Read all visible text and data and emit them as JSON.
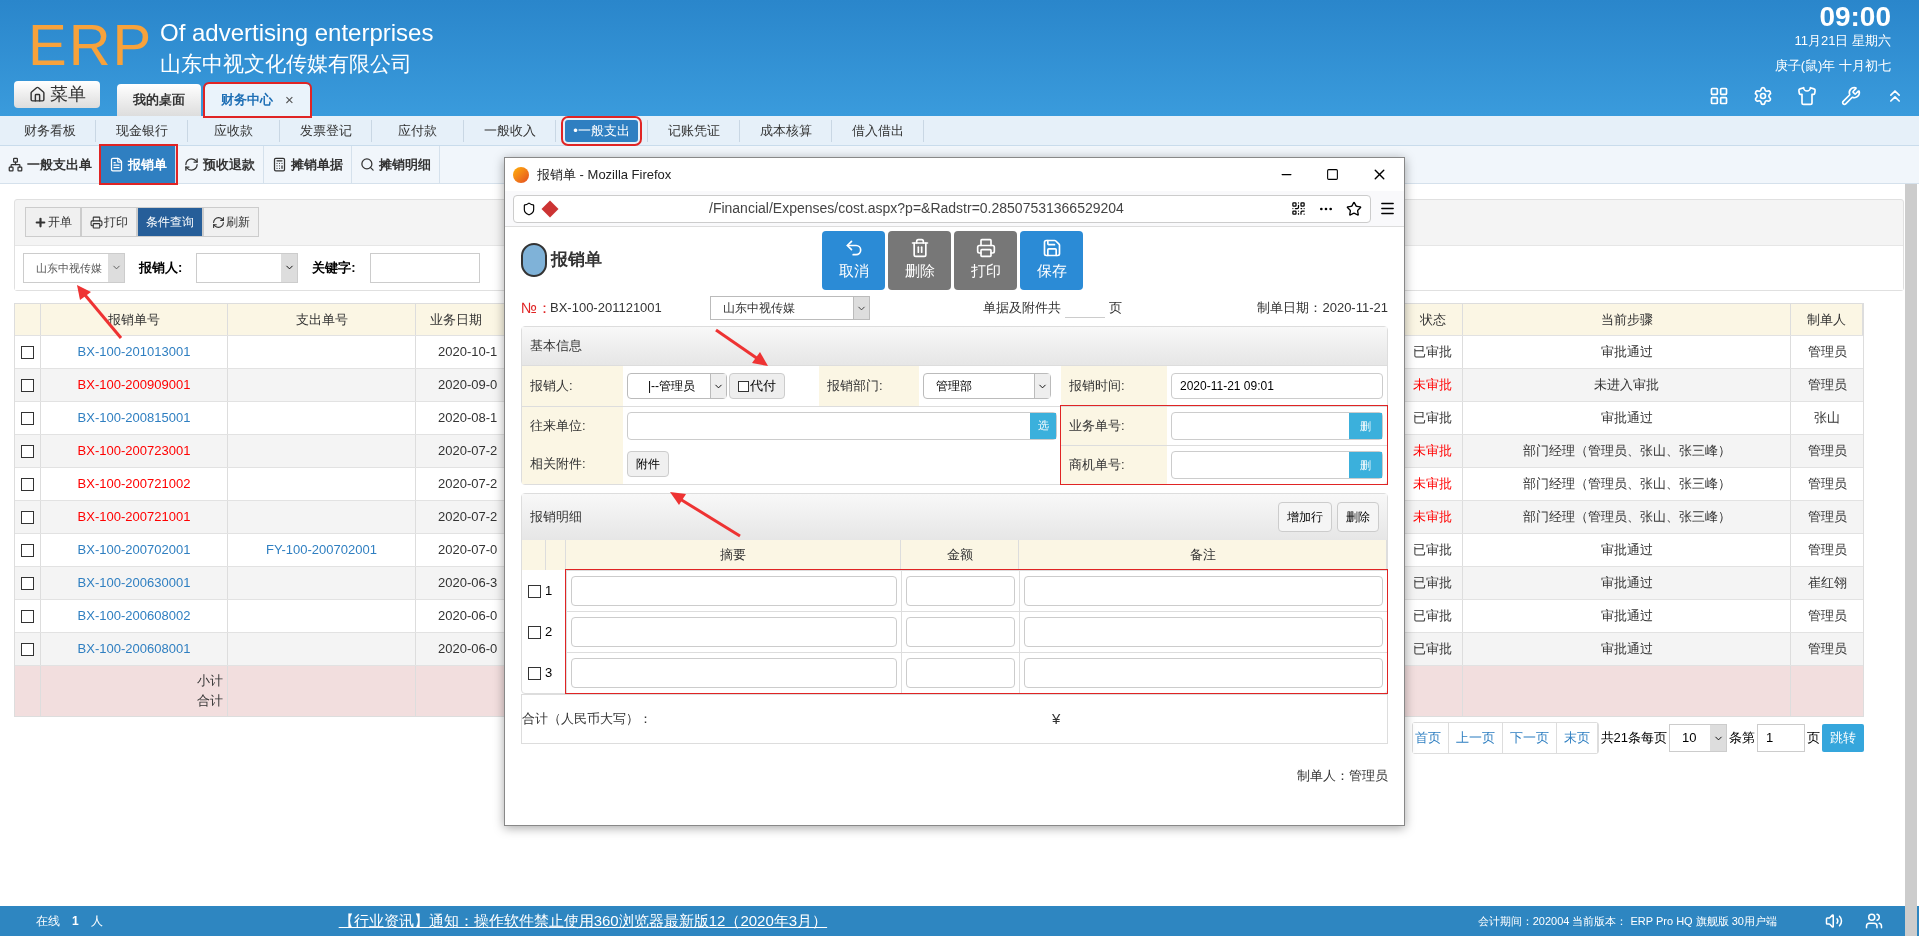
{
  "header": {
    "logo": "ERP",
    "subtitle_en": "Of advertising enterprises",
    "company": "山东中视文化传媒有限公司",
    "time": "09:00",
    "date": "11月21日 星期六",
    "lunar": "庚子(鼠)年 十月初七",
    "menu_button": "菜单"
  },
  "tabs": [
    {
      "label": "我的桌面",
      "selected": false,
      "highlighted": false,
      "closable": false
    },
    {
      "label": "财务中心",
      "selected": true,
      "highlighted": true,
      "closable": true,
      "close": "×"
    }
  ],
  "nav": [
    {
      "label": "财务看板",
      "selected": false
    },
    {
      "label": "现金银行",
      "selected": false
    },
    {
      "label": "应收款",
      "selected": false
    },
    {
      "label": "发票登记",
      "selected": false
    },
    {
      "label": "应付款",
      "selected": false
    },
    {
      "label": "一般收入",
      "selected": false
    },
    {
      "label": "一般支出",
      "selected": true,
      "bullet": "•"
    },
    {
      "label": "记账凭证",
      "selected": false
    },
    {
      "label": "成本核算",
      "selected": false
    },
    {
      "label": "借入借出",
      "selected": false
    }
  ],
  "subtabs": [
    {
      "label": "一般支出单",
      "selected": false
    },
    {
      "label": "报销单",
      "selected": true
    },
    {
      "label": "预收退款",
      "selected": false
    },
    {
      "label": "摊销单据",
      "selected": false
    },
    {
      "label": "摊销明细",
      "selected": false
    }
  ],
  "toolbar": [
    {
      "label": "开单",
      "kind": "add",
      "selected": false
    },
    {
      "label": "打印",
      "kind": "print",
      "selected": false
    },
    {
      "label": "条件查询",
      "kind": "query",
      "selected": true
    },
    {
      "label": "刷新",
      "kind": "refresh",
      "selected": false
    }
  ],
  "filters": {
    "company": "山东中视传媒",
    "person_label": "报销人:",
    "keyword_label": "关键字:"
  },
  "table": {
    "columns": [
      "报销单号",
      "支出单号",
      "业务日期",
      "状态",
      "当前步骤",
      "制单人"
    ],
    "rows": [
      {
        "number": "BX-100-201013001",
        "expense_no": "",
        "date": "2020-10-1",
        "status": "已审批",
        "step": "审批通过",
        "maker": "管理员",
        "flagged": false,
        "checked": false
      },
      {
        "number": "BX-100-200909001",
        "expense_no": "",
        "date": "2020-09-0",
        "status": "未审批",
        "step": "未进入审批",
        "maker": "管理员",
        "flagged": true,
        "checked": false
      },
      {
        "number": "BX-100-200815001",
        "expense_no": "",
        "date": "2020-08-1",
        "status": "已审批",
        "step": "审批通过",
        "maker": "张山",
        "flagged": false,
        "checked": false
      },
      {
        "number": "BX-100-200723001",
        "expense_no": "",
        "date": "2020-07-2",
        "status": "未审批",
        "step": "部门经理（管理员、张山、张三峰）",
        "maker": "管理员",
        "flagged": true,
        "checked": false
      },
      {
        "number": "BX-100-200721002",
        "expense_no": "",
        "date": "2020-07-2",
        "status": "未审批",
        "step": "部门经理（管理员、张山、张三峰）",
        "maker": "管理员",
        "flagged": true,
        "checked": false
      },
      {
        "number": "BX-100-200721001",
        "expense_no": "",
        "date": "2020-07-2",
        "status": "未审批",
        "step": "部门经理（管理员、张山、张三峰）",
        "maker": "管理员",
        "flagged": true,
        "checked": false
      },
      {
        "number": "BX-100-200702001",
        "expense_no": "FY-100-200702001",
        "date": "2020-07-0",
        "status": "已审批",
        "step": "审批通过",
        "maker": "管理员",
        "flagged": false,
        "checked": false
      },
      {
        "number": "BX-100-200630001",
        "expense_no": "",
        "date": "2020-06-3",
        "status": "已审批",
        "step": "审批通过",
        "maker": "崔红翎",
        "flagged": false,
        "checked": false
      },
      {
        "number": "BX-100-200608002",
        "expense_no": "",
        "date": "2020-06-0",
        "status": "已审批",
        "step": "审批通过",
        "maker": "管理员",
        "flagged": false,
        "checked": false
      },
      {
        "number": "BX-100-200608001",
        "expense_no": "",
        "date": "2020-06-0",
        "status": "已审批",
        "step": "审批通过",
        "maker": "管理员",
        "flagged": false,
        "checked": false
      }
    ],
    "subtotal": "小计",
    "total": "合计"
  },
  "pagination": {
    "buttons": [
      "首页",
      "上一页",
      "下一页",
      "末页"
    ],
    "summary": "共21条每页",
    "page_size": "10",
    "page_label": "条第",
    "page": "1",
    "page_suffix": "页",
    "go": "跳转"
  },
  "popup": {
    "title": "报销单 - Mozilla Firefox",
    "url": "/Financial/Expenses/cost.aspx?p=&Radstr=0.28507531366529204",
    "heading": "报销单",
    "actions": [
      {
        "label": "取消",
        "kind": "cancel"
      },
      {
        "label": "删除",
        "kind": "delete"
      },
      {
        "label": "打印",
        "kind": "print"
      },
      {
        "label": "保存",
        "kind": "save"
      }
    ],
    "no_label": "№：",
    "no": "BX-100-201121001",
    "company": "山东中视传媒",
    "pages_label": "单据及附件共",
    "pages_suffix": "页",
    "date_label": "制单日期：",
    "date": "2020-11-21",
    "basic_title": "基本信息",
    "person_label": "报销人:",
    "person": "|--管理员",
    "proxy": "代付",
    "proxy_checked": false,
    "dept_label": "报销部门:",
    "dept": "管理部",
    "time_label": "报销时间:",
    "time": "2020-11-21 09:01",
    "partner_label": "往来单位:",
    "pick": "选",
    "attach_label": "相关附件:",
    "attach": "附件",
    "refs": [
      {
        "label": "业务单号:",
        "action": "删"
      },
      {
        "label": "商机单号:",
        "action": "删"
      }
    ],
    "refs_highlighted": true,
    "detail_title": "报销明细",
    "add_row": "增加行",
    "delete": "删除",
    "detail_columns": [
      "摘要",
      "金额",
      "备注"
    ],
    "detail_rows": [
      {
        "index": "1",
        "checked": false
      },
      {
        "index": "2",
        "checked": false
      },
      {
        "index": "3",
        "checked": false
      }
    ],
    "detail_highlighted": true,
    "total_label": "合计（人民币大写）：",
    "currency": "¥",
    "maker": "制单人：管理员"
  },
  "status_bar": {
    "online": "在线",
    "online_count": "1",
    "online_unit": "人",
    "notice": "【行业资讯】通知：操作软件禁止使用360浏览器最新版12（2020年3月）",
    "version": "会计期间：202004 当前版本： ERP Pro HQ 旗舰版 30用户端"
  }
}
